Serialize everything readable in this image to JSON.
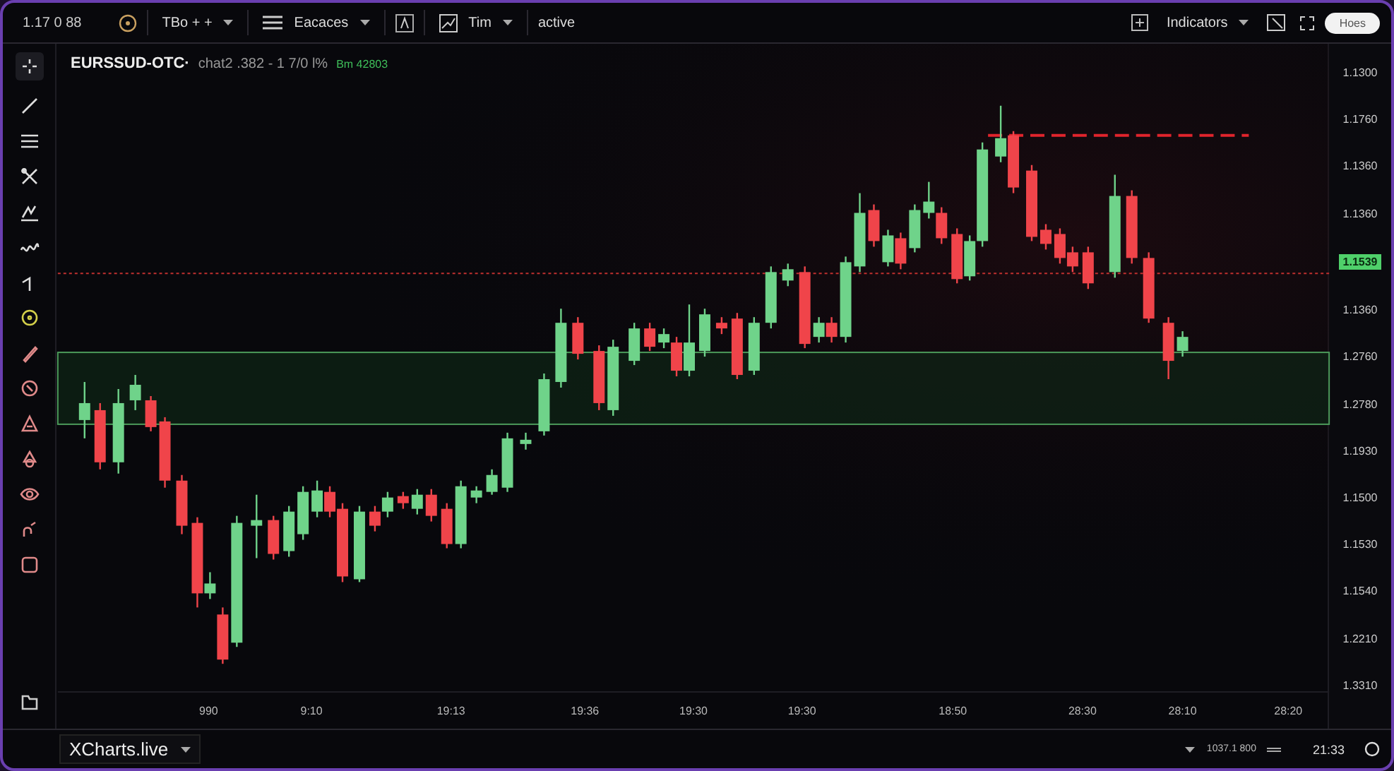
{
  "top_bar": {
    "price": "1.17 0 88",
    "menus": [
      {
        "label": "TBo + +",
        "kind": "plain"
      },
      {
        "label": "Eacaces",
        "kind": "bars"
      },
      {
        "label": "Tim",
        "kind": "chart"
      }
    ],
    "status": "active",
    "indicators": "Indicators",
    "pill": "Hoes"
  },
  "symbol": {
    "name": "EURSSUD-OTC·",
    "details": "chat2 .382 - 1 7/0 l%",
    "change": "Bm 42803"
  },
  "price_axis": [
    {
      "text": "1.1300",
      "kind": "tick"
    },
    {
      "text": "1.1760",
      "kind": "tick"
    },
    {
      "text": "1.1360",
      "kind": "tick"
    },
    {
      "text": "1.1360",
      "kind": "tick"
    },
    {
      "text": "1.1539",
      "kind": "current"
    },
    {
      "text": "1.1360",
      "kind": "tick"
    },
    {
      "text": "1.2760",
      "kind": "tick"
    },
    {
      "text": "1.2780",
      "kind": "tick"
    },
    {
      "text": "1.1930",
      "kind": "tick"
    },
    {
      "text": "1.1500",
      "kind": "tick"
    },
    {
      "text": "1.1530",
      "kind": "tick"
    },
    {
      "text": "1.1540",
      "kind": "tick"
    },
    {
      "text": "1.2210",
      "kind": "tick"
    },
    {
      "text": "1.3310",
      "kind": "tick"
    }
  ],
  "time_axis": [
    "990",
    "9:10",
    "19:13",
    "19:36",
    "19:30",
    "19:30",
    "18:50",
    "28:30",
    "28:10",
    "28:20"
  ],
  "footer": {
    "brand": "XCharts.live",
    "status": "1037.1 800",
    "time": "21:33"
  }
}
